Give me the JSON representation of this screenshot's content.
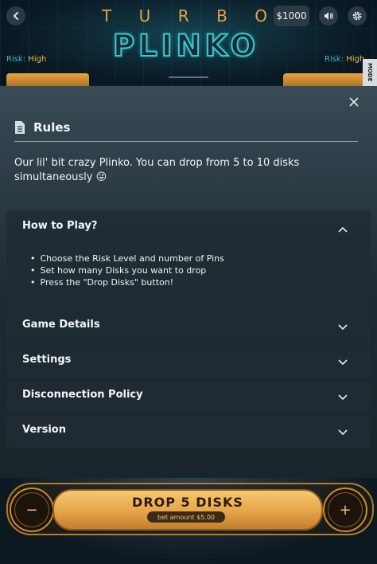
{
  "header": {
    "turbo_letters": [
      "T",
      "U",
      "R",
      "B",
      "O"
    ],
    "title": "PLINKO",
    "balance": "$1000",
    "risk_left_label": "Risk:",
    "risk_left_value": "High",
    "risk_right_label": "Risk:",
    "risk_right_value": "High",
    "mode_tab": "MODE",
    "icons": {
      "back": "chevron-left-icon",
      "sound": "speaker-icon",
      "settings": "gear-icon"
    }
  },
  "rules": {
    "title": "Rules",
    "intro": "Our lil' bit crazy Plinko. You can drop from 5 to 10 disks simultaneously 😜",
    "sections": [
      {
        "title": "How to Play?",
        "expanded": true,
        "items": [
          "Choose the Risk Level and number of Pins",
          "Set how many Disks you want to drop",
          "Press the \"Drop Disks\" button!"
        ]
      },
      {
        "title": "Game Details",
        "expanded": false
      },
      {
        "title": "Settings",
        "expanded": false
      },
      {
        "title": "Disconnection Policy",
        "expanded": false
      },
      {
        "title": "Version",
        "expanded": false
      }
    ]
  },
  "drop": {
    "minus": "−",
    "plus": "+",
    "label": "DROP 5 DISKS",
    "bet_amount": "bet amount $5.00"
  },
  "colors": {
    "accent_orange": "#e5a447",
    "accent_teal": "#38c9d2"
  }
}
